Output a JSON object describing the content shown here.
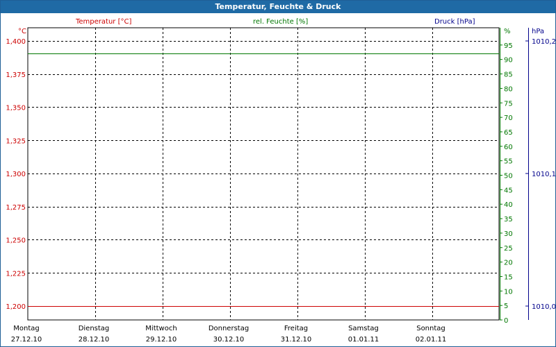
{
  "window": {
    "title": "Temperatur, Feuchte & Druck"
  },
  "colors": {
    "temperature": "#cc0000",
    "humidity": "#007700",
    "pressure": "#00008b",
    "grid": "#000000"
  },
  "chart_data": {
    "type": "line",
    "title": "Temperatur, Feuchte & Druck",
    "grid": true,
    "x_ticks": [
      {
        "day": "Montag",
        "date": "27.12.10"
      },
      {
        "day": "Dienstag",
        "date": "28.12.10"
      },
      {
        "day": "Mittwoch",
        "date": "29.12.10"
      },
      {
        "day": "Donnerstag",
        "date": "30.12.10"
      },
      {
        "day": "Freitag",
        "date": "31.12.10"
      },
      {
        "day": "Samstag",
        "date": "01.01.11"
      },
      {
        "day": "Sonntag",
        "date": "02.01.11"
      }
    ],
    "axes": {
      "temperature": {
        "label": "Temperatur [°C]",
        "unit": "°C",
        "position": "left",
        "ylim": [
          1.2,
          1.4
        ],
        "ticks": [
          "1,400",
          "1,375",
          "1,350",
          "1,325",
          "1,300",
          "1,275",
          "1,250",
          "1,225",
          "1,200"
        ]
      },
      "humidity": {
        "label": "rel. Feuchte [%]",
        "unit": "%",
        "position": "right",
        "ylim": [
          0,
          100
        ],
        "ticks": [
          "95",
          "90",
          "85",
          "80",
          "75",
          "70",
          "65",
          "60",
          "55",
          "50",
          "45",
          "40",
          "35",
          "30",
          "25",
          "20",
          "15",
          "10",
          "5",
          "0"
        ]
      },
      "pressure": {
        "label": "Druck [hPa]",
        "unit": "hPa",
        "position": "right",
        "ylim": [
          1010.0,
          1010.2
        ],
        "ticks": [
          "1010,2",
          "1010,1",
          "1010,0"
        ]
      }
    },
    "series": [
      {
        "axis": "humidity",
        "values": [
          92,
          92,
          92,
          92,
          92,
          92,
          92,
          92
        ]
      },
      {
        "axis": "temperature",
        "values": [
          1.2,
          1.2,
          1.2,
          1.2,
          1.2,
          1.2,
          1.2,
          1.2
        ]
      }
    ]
  }
}
